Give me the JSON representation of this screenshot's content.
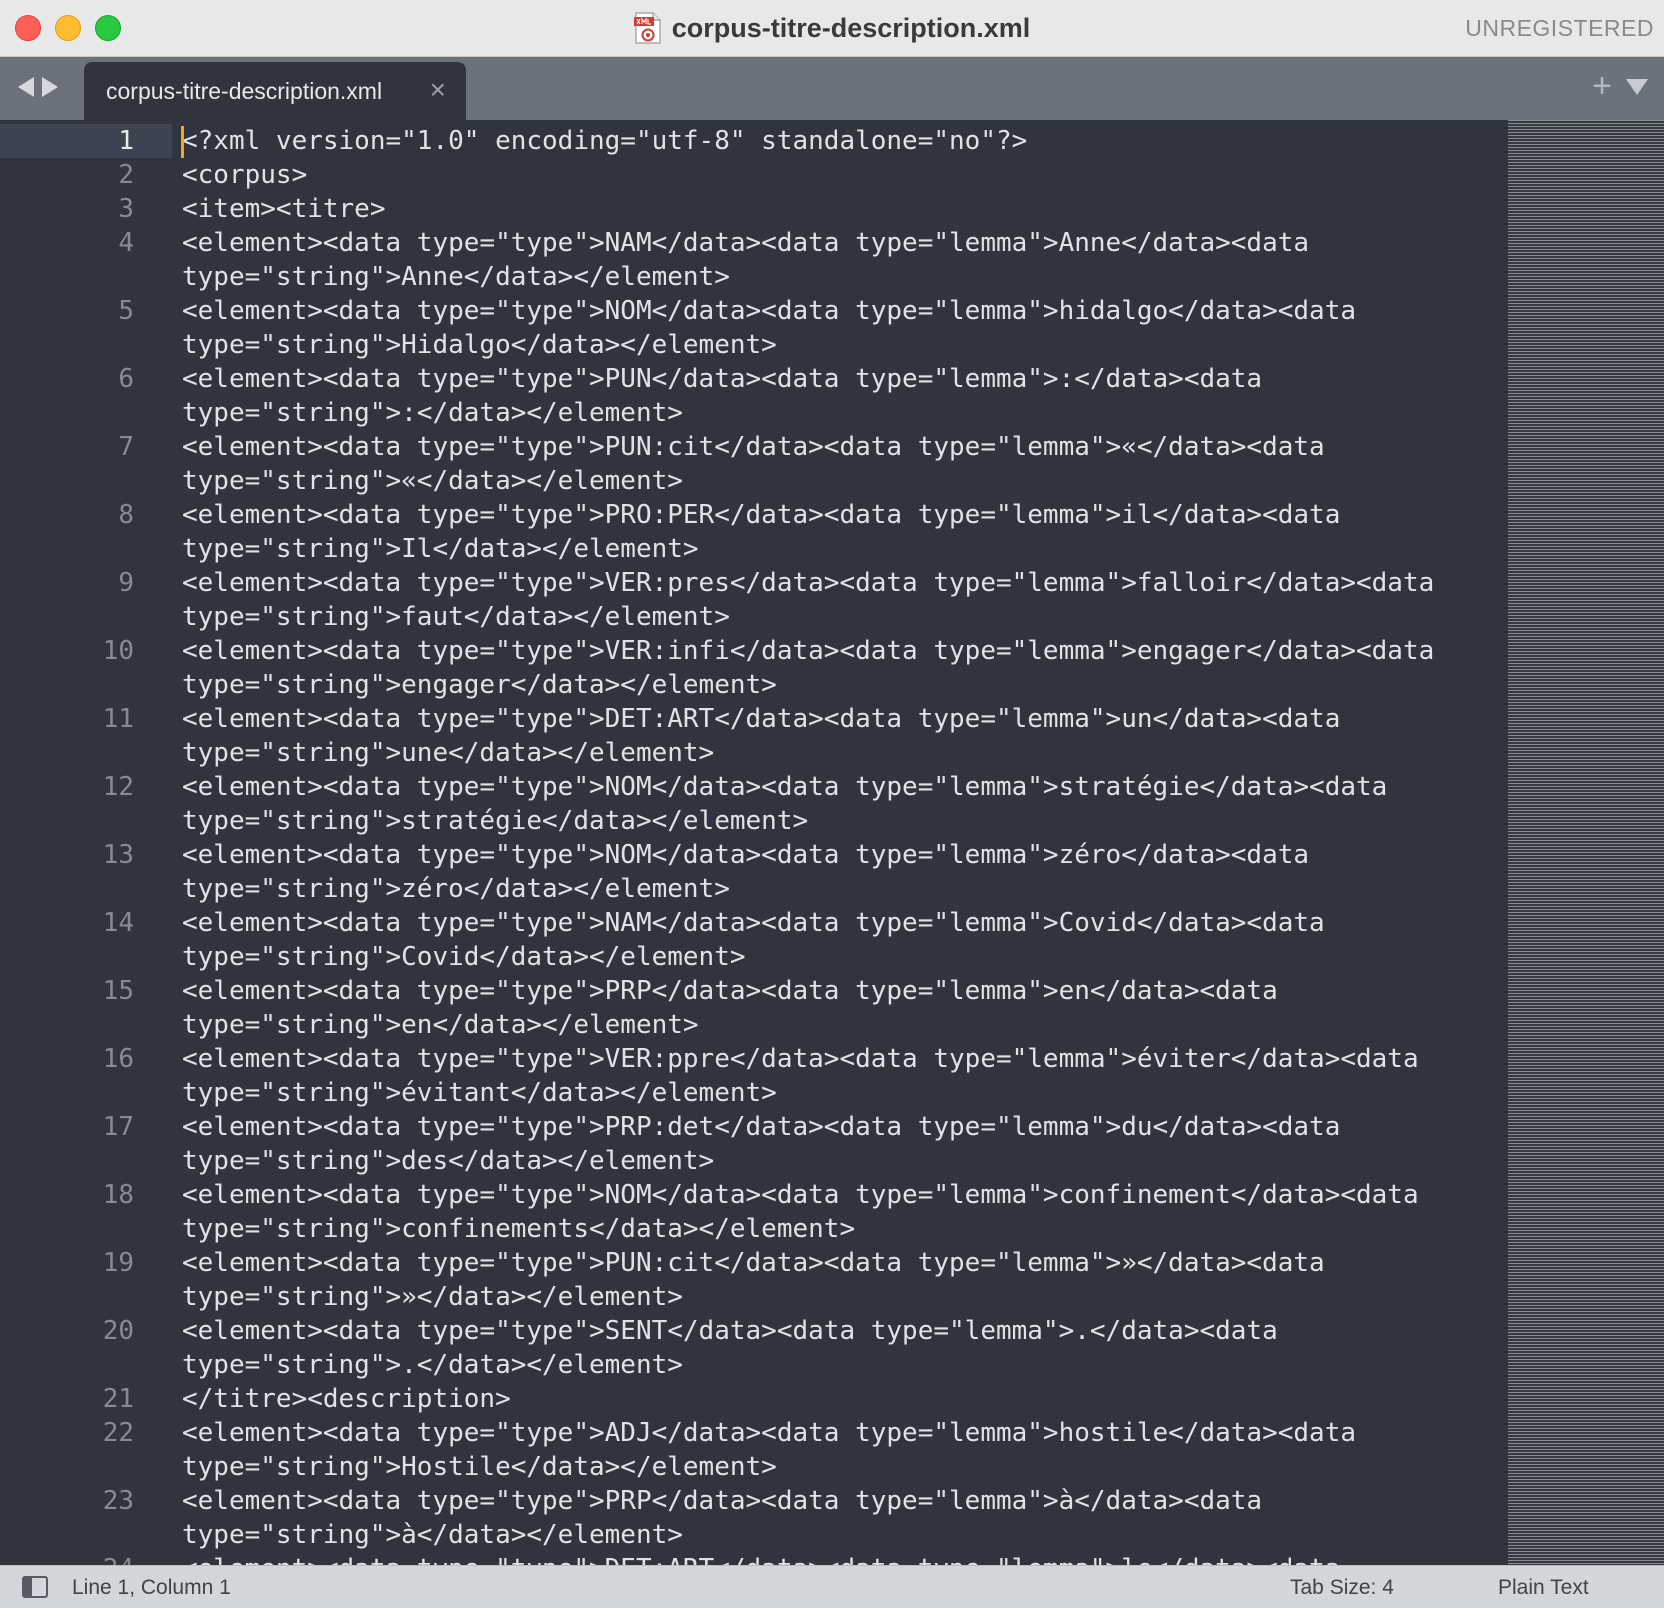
{
  "window": {
    "title": "corpus-titre-description.xml",
    "registration_status": "UNREGISTERED"
  },
  "tabs": [
    {
      "label": "corpus-titre-description.xml",
      "active": true,
      "close_glyph": "×"
    }
  ],
  "tabbar": {
    "new_tab_glyph": "+"
  },
  "editor": {
    "current_line": 1,
    "lines": [
      {
        "n": "1",
        "text": "<?xml version=\"1.0\" encoding=\"utf-8\" standalone=\"no\"?>"
      },
      {
        "n": "2",
        "text": "<corpus>"
      },
      {
        "n": "3",
        "text": "<item><titre>"
      },
      {
        "n": "4",
        "text": "<element><data type=\"type\">NAM</data><data type=\"lemma\">Anne</data><data type=\"string\">Anne</data></element>"
      },
      {
        "n": "5",
        "text": "<element><data type=\"type\">NOM</data><data type=\"lemma\">hidalgo</data><data type=\"string\">Hidalgo</data></element>"
      },
      {
        "n": "6",
        "text": "<element><data type=\"type\">PUN</data><data type=\"lemma\">:</data><data type=\"string\">:</data></element>"
      },
      {
        "n": "7",
        "text": "<element><data type=\"type\">PUN:cit</data><data type=\"lemma\">«</data><data type=\"string\">«</data></element>"
      },
      {
        "n": "8",
        "text": "<element><data type=\"type\">PRO:PER</data><data type=\"lemma\">il</data><data type=\"string\">Il</data></element>"
      },
      {
        "n": "9",
        "text": "<element><data type=\"type\">VER:pres</data><data type=\"lemma\">falloir</data><data type=\"string\">faut</data></element>"
      },
      {
        "n": "10",
        "text": "<element><data type=\"type\">VER:infi</data><data type=\"lemma\">engager</data><data type=\"string\">engager</data></element>"
      },
      {
        "n": "11",
        "text": "<element><data type=\"type\">DET:ART</data><data type=\"lemma\">un</data><data type=\"string\">une</data></element>"
      },
      {
        "n": "12",
        "text": "<element><data type=\"type\">NOM</data><data type=\"lemma\">stratégie</data><data type=\"string\">stratégie</data></element>"
      },
      {
        "n": "13",
        "text": "<element><data type=\"type\">NOM</data><data type=\"lemma\">zéro</data><data type=\"string\">zéro</data></element>"
      },
      {
        "n": "14",
        "text": "<element><data type=\"type\">NAM</data><data type=\"lemma\">Covid</data><data type=\"string\">Covid</data></element>"
      },
      {
        "n": "15",
        "text": "<element><data type=\"type\">PRP</data><data type=\"lemma\">en</data><data type=\"string\">en</data></element>"
      },
      {
        "n": "16",
        "text": "<element><data type=\"type\">VER:ppre</data><data type=\"lemma\">éviter</data><data type=\"string\">évitant</data></element>"
      },
      {
        "n": "17",
        "text": "<element><data type=\"type\">PRP:det</data><data type=\"lemma\">du</data><data type=\"string\">des</data></element>"
      },
      {
        "n": "18",
        "text": "<element><data type=\"type\">NOM</data><data type=\"lemma\">confinement</data><data type=\"string\">confinements</data></element>"
      },
      {
        "n": "19",
        "text": "<element><data type=\"type\">PUN:cit</data><data type=\"lemma\">»</data><data type=\"string\">»</data></element>"
      },
      {
        "n": "20",
        "text": "<element><data type=\"type\">SENT</data><data type=\"lemma\">.</data><data type=\"string\">.</data></element>"
      },
      {
        "n": "21",
        "text": "</titre><description>"
      },
      {
        "n": "22",
        "text": "<element><data type=\"type\">ADJ</data><data type=\"lemma\">hostile</data><data type=\"string\">Hostile</data></element>"
      },
      {
        "n": "23",
        "text": "<element><data type=\"type\">PRP</data><data type=\"lemma\">à</data><data type=\"string\">à</data></element>"
      },
      {
        "n": "24",
        "text": "<element><data type=\"type\">DET:ART</data><data type=\"lemma\">le</data><data type=\"string\">"
      }
    ]
  },
  "statusbar": {
    "position": "Line 1, Column 1",
    "tab_size": "Tab Size: 4",
    "syntax": "Plain Text"
  },
  "colors": {
    "editor_bg": "#2f343f",
    "caret": "#f5a623",
    "tab_bar": "#6c727c",
    "close_button": "#fe5f57",
    "minimize_button": "#febc2e",
    "zoom_button": "#28c840"
  }
}
